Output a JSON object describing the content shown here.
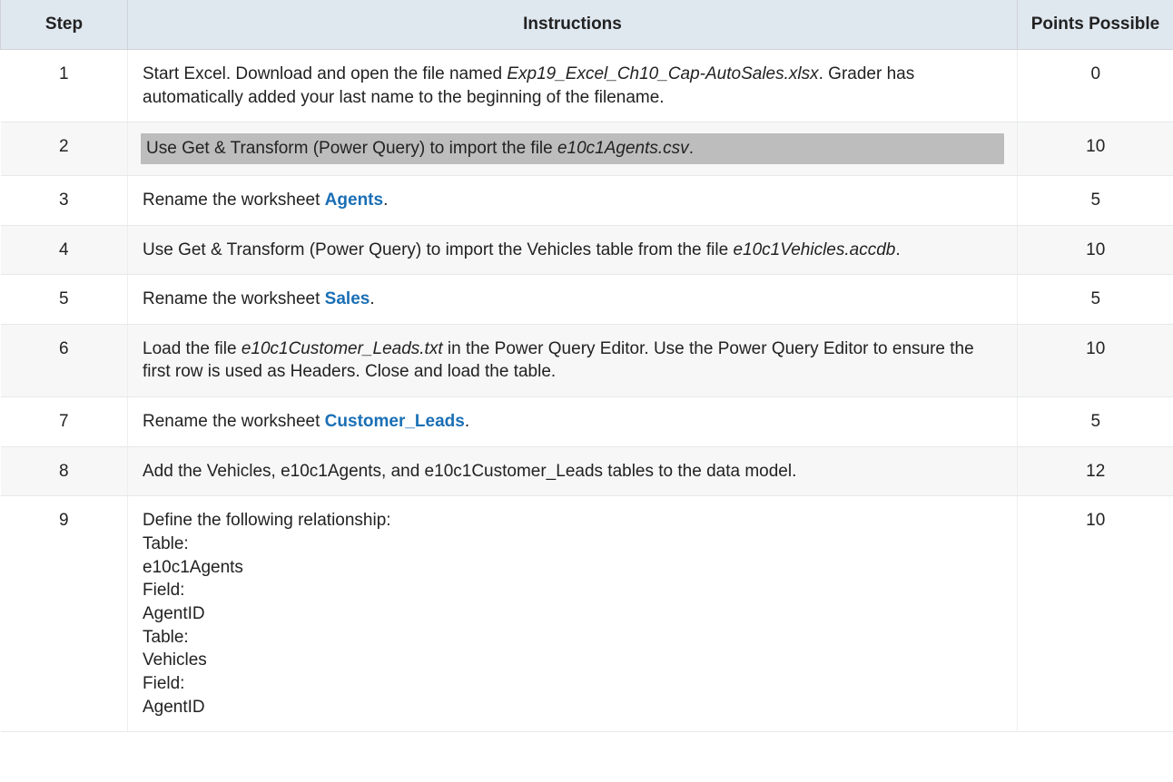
{
  "headers": {
    "step": "Step",
    "instructions": "Instructions",
    "points": "Points Possible"
  },
  "rows": [
    {
      "step": "1",
      "points": "0",
      "segments": [
        {
          "t": "Start Excel. Download and open the file named "
        },
        {
          "t": "Exp19_Excel_Ch10_Cap-AutoSales.xlsx",
          "cls": "ital"
        },
        {
          "t": ". Grader has automatically added your last name to the beginning of the filename."
        }
      ]
    },
    {
      "step": "2",
      "points": "10",
      "highlight": true,
      "segments": [
        {
          "t": "Use Get & Transform (Power Query) to import the file "
        },
        {
          "t": "e10c1Agents.csv",
          "cls": "ital"
        },
        {
          "t": "."
        }
      ]
    },
    {
      "step": "3",
      "points": "5",
      "segments": [
        {
          "t": "Rename the worksheet "
        },
        {
          "t": "Agents",
          "cls": "link-like"
        },
        {
          "t": "."
        }
      ]
    },
    {
      "step": "4",
      "points": "10",
      "segments": [
        {
          "t": "Use Get & Transform (Power Query) to import the Vehicles table from the file "
        },
        {
          "t": "e10c1Vehicles.accdb",
          "cls": "ital"
        },
        {
          "t": "."
        }
      ]
    },
    {
      "step": "5",
      "points": "5",
      "segments": [
        {
          "t": "Rename the worksheet "
        },
        {
          "t": "Sales",
          "cls": "link-like"
        },
        {
          "t": "."
        }
      ]
    },
    {
      "step": "6",
      "points": "10",
      "segments": [
        {
          "t": "Load the file "
        },
        {
          "t": "e10c1Customer_Leads.txt",
          "cls": "ital"
        },
        {
          "t": " in the Power Query Editor. Use the Power Query Editor to ensure the first row is used as Headers. Close and load the table."
        }
      ]
    },
    {
      "step": "7",
      "points": "5",
      "segments": [
        {
          "t": "Rename the worksheet "
        },
        {
          "t": "Customer_Leads",
          "cls": "link-like"
        },
        {
          "t": "."
        }
      ]
    },
    {
      "step": "8",
      "points": "12",
      "segments": [
        {
          "t": "Add the Vehicles, e10c1Agents, and e10c1Customer_Leads tables to the data model."
        }
      ]
    },
    {
      "step": "9",
      "points": "10",
      "segments": [
        {
          "t": "Define the following relationship:"
        },
        {
          "br": true
        },
        {
          "t": "Table:"
        },
        {
          "br": true
        },
        {
          "t": "e10c1Agents"
        },
        {
          "br": true
        },
        {
          "t": "Field:"
        },
        {
          "br": true
        },
        {
          "t": "AgentID"
        },
        {
          "br": true
        },
        {
          "t": "Table:"
        },
        {
          "br": true
        },
        {
          "t": "Vehicles"
        },
        {
          "br": true
        },
        {
          "t": "Field:"
        },
        {
          "br": true
        },
        {
          "t": "AgentID"
        }
      ]
    }
  ]
}
